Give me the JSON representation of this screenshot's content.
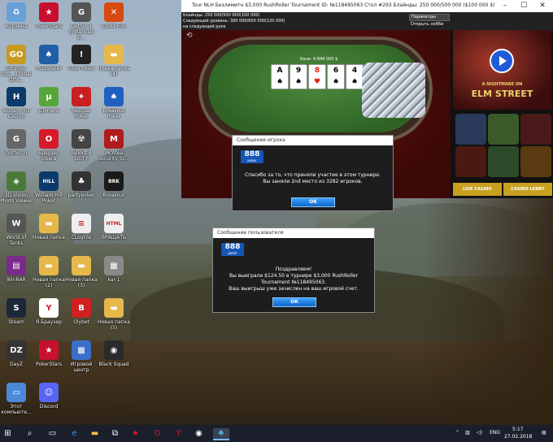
{
  "desktop_icons": [
    {
      "label": "Корзина",
      "icon": "recycle-bin-icon",
      "color": "#6aa0d8",
      "glyph": "♻"
    },
    {
      "label": "PokerStars",
      "icon": "pokerstars-icon",
      "color": "#c8102e",
      "glyph": "★"
    },
    {
      "label": "Gothic 3 Enhanced E...",
      "icon": "gothic-icon",
      "color": "#555555",
      "glyph": "G"
    },
    {
      "label": "Cross Fire",
      "icon": "crossfire-icon",
      "color": "#d84a10",
      "glyph": "✕"
    },
    {
      "label": "Counter-Stri... Global Offe...",
      "icon": "csgo-icon",
      "color": "#c89a20",
      "glyph": "GO"
    },
    {
      "label": "PSUpdater",
      "icon": "psupdater-icon",
      "color": "#1f5fa8",
      "glyph": "♠"
    },
    {
      "label": "Titan Poker",
      "icon": "titan-poker-icon",
      "color": "#222222",
      "glyph": "!"
    },
    {
      "label": "Новая папка (4)",
      "icon": "folder-icon",
      "color": "#e6b84a",
      "glyph": "▬"
    },
    {
      "label": "William Hill Casino",
      "icon": "william-hill-icon",
      "color": "#0a3a6a",
      "glyph": "H"
    },
    {
      "label": "µTorrent",
      "icon": "utorrent-icon",
      "color": "#57a639",
      "glyph": "µ"
    },
    {
      "label": "RedStar Poker",
      "icon": "redstar-poker-icon",
      "color": "#c82020",
      "glyph": "✦"
    },
    {
      "label": "Breakout Poker",
      "icon": "breakout-poker-icon",
      "color": "#2060c0",
      "glyph": "♠"
    },
    {
      "label": "Gothic III",
      "icon": "gothic3-icon",
      "color": "#666666",
      "glyph": "G"
    },
    {
      "label": "Браузер Opera",
      "icon": "opera-icon",
      "color": "#d51b2a",
      "glyph": "O"
    },
    {
      "label": "Fallout 4 GOTY",
      "icon": "fallout-icon",
      "color": "#444444",
      "glyph": "☢"
    },
    {
      "label": "McAfee Security Sc...",
      "icon": "mcafee-icon",
      "color": "#b01c1c",
      "glyph": "M"
    },
    {
      "label": "3D Vision Photo Viewer",
      "icon": "3d-vision-icon",
      "color": "#4a7a3a",
      "glyph": "◈"
    },
    {
      "label": "William Hill Poker",
      "icon": "william-hill-poker-icon",
      "color": "#0a3a6a",
      "glyph": "HILL"
    },
    {
      "label": "partypoker",
      "icon": "partypoker-icon",
      "color": "#333333",
      "glyph": "♣"
    },
    {
      "label": "Breakout",
      "icon": "breakout-icon",
      "color": "#1a1a1a",
      "glyph": "BRK"
    },
    {
      "label": "World of Tanks",
      "icon": "world-of-tanks-icon",
      "color": "#555555",
      "glyph": "W"
    },
    {
      "label": "Новая папка",
      "icon": "folder-icon",
      "color": "#e6b84a",
      "glyph": "▬"
    },
    {
      "label": "CLogFile",
      "icon": "text-file-icon",
      "color": "#eeeeee",
      "glyph": "≡"
    },
    {
      "label": "ВРАЩАТЬ",
      "icon": "html-file-icon",
      "color": "#eeeeee",
      "glyph": "HTML"
    },
    {
      "label": "WinRAR",
      "icon": "winrar-icon",
      "color": "#7a2a8a",
      "glyph": "▤"
    },
    {
      "label": "Новая папка (2)",
      "icon": "folder-icon",
      "color": "#e6b84a",
      "glyph": "▬"
    },
    {
      "label": "Новая папка (3)",
      "icon": "folder-icon",
      "color": "#e6b84a",
      "glyph": "▬"
    },
    {
      "label": "kar-1",
      "icon": "image-file-icon",
      "color": "#8a8a8a",
      "glyph": "▦"
    },
    {
      "label": "Steam",
      "icon": "steam-icon",
      "color": "#1b2838",
      "glyph": "S"
    },
    {
      "label": "Я.Браузер",
      "icon": "yandex-browser-icon",
      "color": "#ffffff",
      "glyph": "Y"
    },
    {
      "label": "Olybet",
      "icon": "olybet-icon",
      "color": "#d02020",
      "glyph": "B"
    },
    {
      "label": "Новая папка (5)",
      "icon": "folder-icon",
      "color": "#e6b84a",
      "glyph": "▬"
    },
    {
      "label": "DayZ",
      "icon": "dayz-icon",
      "color": "#333333",
      "glyph": "DZ"
    },
    {
      "label": "PokerStars",
      "icon": "pokerstars-icon",
      "color": "#c8102e",
      "glyph": "★"
    },
    {
      "label": "Игровой центр",
      "icon": "game-center-icon",
      "color": "#3a70c8",
      "glyph": "▩"
    },
    {
      "label": "Black Squad",
      "icon": "black-squad-icon",
      "color": "#2a2a2a",
      "glyph": "◉"
    },
    {
      "label": "Этот компьюте...",
      "icon": "this-pc-icon",
      "color": "#4a8ad8",
      "glyph": "▭"
    },
    {
      "label": "Discord",
      "icon": "discord-icon",
      "color": "#5865f2",
      "glyph": "☺"
    }
  ],
  "poker_window": {
    "title": "Tour NLH Безлимитн $3,000 RushRoller Tournament ID: №118495063 Стол #293 Блайнды: 250 000/500 000 ($100 000 $)",
    "info_line1": "Блайнды: 250 000/500 000(100 000)",
    "info_line2": "Следующий уровень: 300 000/600 000(120 000)",
    "info_line3": "на следующей руке",
    "options_label": "Параметры",
    "lobby_label": "Открыть лобби",
    "bank_label": "Банк: 9 846 000 $",
    "cards": [
      {
        "rank": "A",
        "suit": "♠",
        "red": false
      },
      {
        "rank": "9",
        "suit": "♠",
        "red": false
      },
      {
        "rank": "8",
        "suit": "♥",
        "red": true
      },
      {
        "rank": "6",
        "suit": "♠",
        "red": false
      },
      {
        "rank": "4",
        "suit": "♠",
        "red": false
      }
    ],
    "ads": {
      "movie_line1": "A NIGHTMARE ON",
      "movie_line2": "ELM STREET",
      "live_casino": "LIVE CASINO",
      "casino_lobby": "CASINO LOBBY"
    }
  },
  "player_dialog": {
    "header": "Сообщение игрока",
    "logo": "888",
    "logo_sub": "poker",
    "line1": "Спасибо за то, что приняли участие в этом турнире.",
    "line2": "Вы заняли 2nd место из 3282 игроков.",
    "ok": "OK"
  },
  "user_dialog": {
    "header": "Сообщение пользователя",
    "logo": "888",
    "logo_sub": "poker",
    "line1": "Поздравляем!",
    "line2": "Вы выиграли $124.50 в турнире $3,000 RushRoller",
    "line3": "Tournament №118495063.",
    "line4": "Ваш выигрыш уже зачислен на ваш игровой счет.",
    "ok": "OK"
  },
  "taskbar": {
    "language": "ENG",
    "time": "5:17",
    "date": "27.02.2018"
  },
  "colors": {
    "dialog_button": "#1e7fe0",
    "brand_888": "#1557b8"
  }
}
